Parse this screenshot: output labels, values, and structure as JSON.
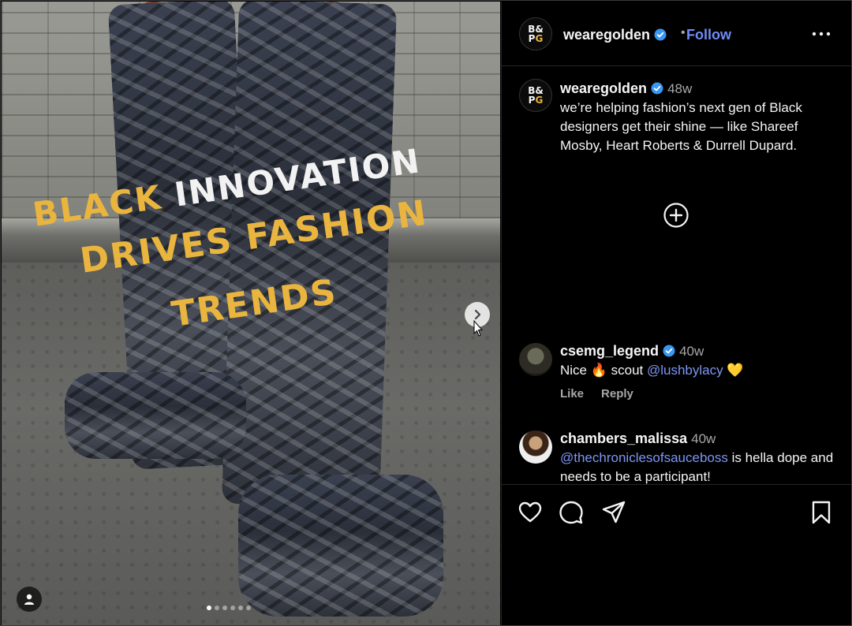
{
  "post": {
    "image_headline": {
      "line1_gold": "BLACK",
      "line1_white": "INNOVATION",
      "line2": "DRIVES FASHION",
      "line3": "TRENDS"
    },
    "carousel_dots": 6,
    "active_dot": 1
  },
  "header": {
    "logo_row1": "B&",
    "logo_row2_a": "P",
    "logo_row2_b": "G",
    "username": "wearegolden",
    "separator": "•",
    "follow_label": "Follow"
  },
  "caption": {
    "username": "wearegolden",
    "age": "48w",
    "text": "we’re helping fashion’s next gen of Black designers get their shine — like Shareef Mosby, Heart Roberts & Durrell Dupard."
  },
  "comments": [
    {
      "username": "csemg_legend",
      "verified": true,
      "age": "40w",
      "text_before": "Nice 🔥 scout ",
      "mention": "@lushbylacy",
      "text_after": " 💛",
      "like_label": "Like",
      "reply_label": "Reply"
    },
    {
      "username": "chambers_malissa",
      "verified": false,
      "age": "40w",
      "mention": "@thechroniclesofsauceboss",
      "text_after": " is hella dope and needs to be a participant!"
    }
  ],
  "colors": {
    "background": "#000000",
    "accent_link": "#6f8cf5",
    "headline_gold": "#eab53e",
    "verified_blue": "#3897f0"
  },
  "icons": [
    "more-icon",
    "verified-icon",
    "add-comment-icon",
    "heart-icon",
    "comment-icon",
    "share-icon",
    "bookmark-icon",
    "next-arrow-icon",
    "user-tag-icon"
  ]
}
